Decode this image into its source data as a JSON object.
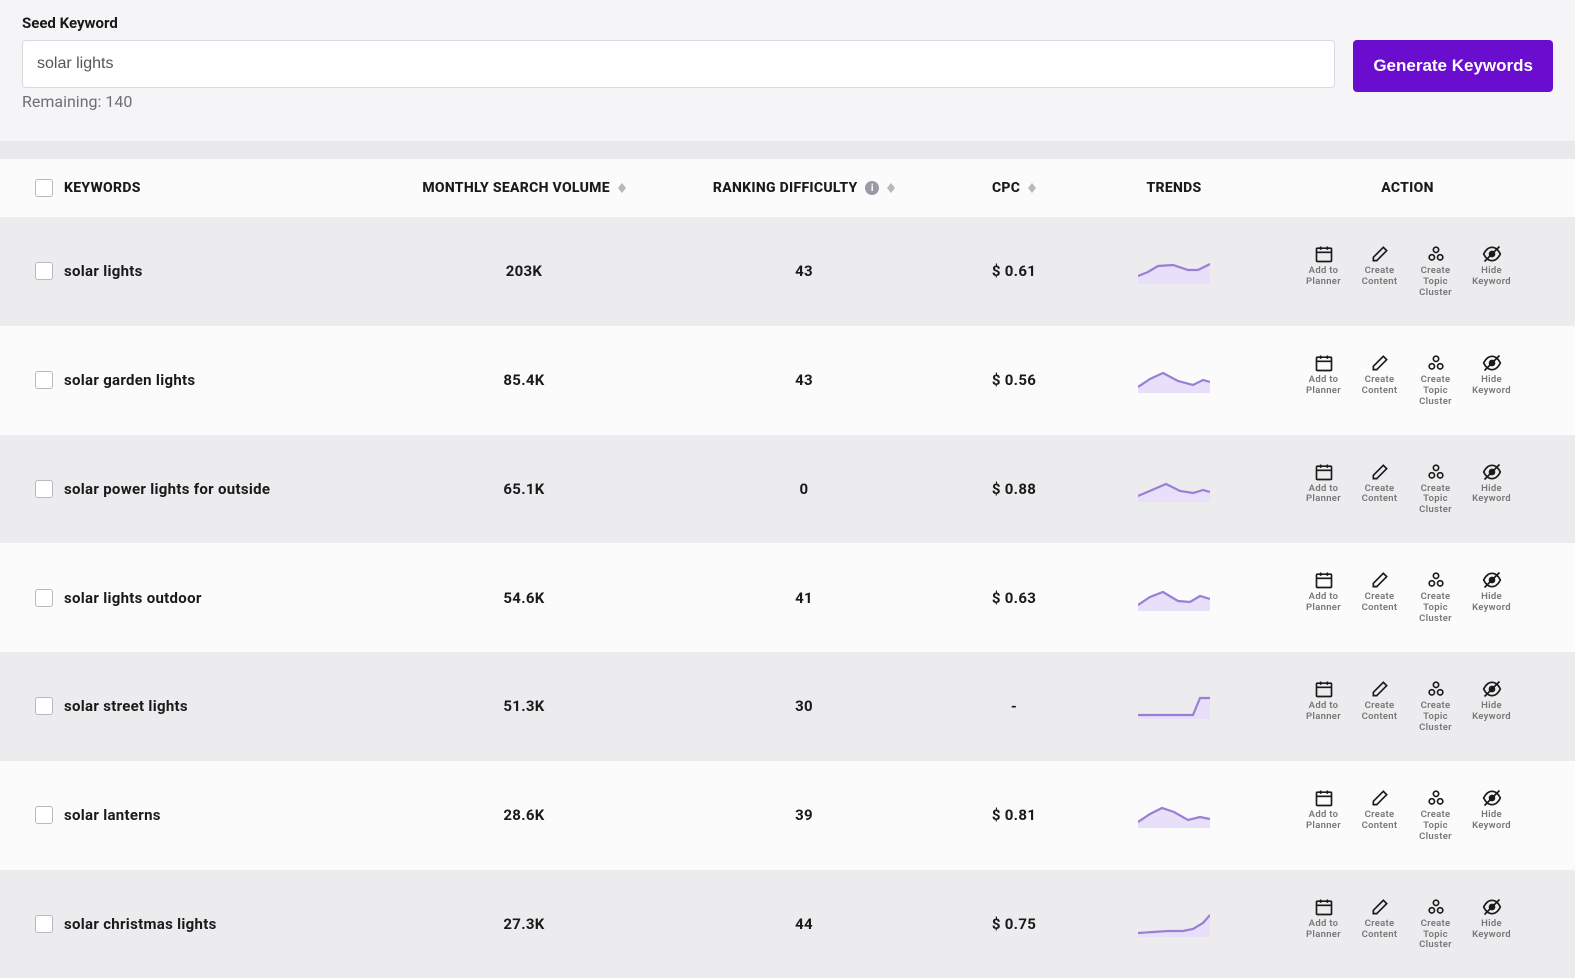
{
  "seed": {
    "label": "Seed Keyword",
    "value": "solar lights",
    "remaining": "Remaining: 140",
    "button": "Generate Keywords"
  },
  "headers": {
    "keywords": "KEYWORDS",
    "volume": "MONTHLY SEARCH VOLUME",
    "difficulty": "RANKING DIFFICULTY",
    "cpc": "CPC",
    "trends": "TRENDS",
    "action": "ACTION"
  },
  "actions": {
    "planner": "Add to Planner",
    "content": "Create Content",
    "cluster": "Create Topic Cluster",
    "hide": "Hide Keyword"
  },
  "rows": [
    {
      "keyword": "solar lights",
      "volume": "203K",
      "difficulty": "43",
      "cpc": "$ 0.61",
      "trend": "0,18 10,14 20,8 35,7 50,12 60,12 72,6"
    },
    {
      "keyword": "solar garden lights",
      "volume": "85.4K",
      "difficulty": "43",
      "cpc": "$ 0.56",
      "trend": "0,20 12,12 25,6 40,14 55,18 65,13 72,15"
    },
    {
      "keyword": "solar power lights for outside",
      "volume": "65.1K",
      "difficulty": "0",
      "cpc": "$ 0.88",
      "trend": "0,20 14,14 28,8 42,15 55,17 65,14 72,16"
    },
    {
      "keyword": "solar lights outdoor",
      "volume": "54.6K",
      "difficulty": "41",
      "cpc": "$ 0.63",
      "trend": "0,20 12,12 25,7 40,16 52,17 62,11 72,14"
    },
    {
      "keyword": "solar street lights",
      "volume": "51.3K",
      "difficulty": "30",
      "cpc": "-",
      "trend": "0,22 15,22 30,22 45,22 55,22 62,5 72,5"
    },
    {
      "keyword": "solar lanterns",
      "volume": "28.6K",
      "difficulty": "39",
      "cpc": "$ 0.81",
      "trend": "0,20 12,12 24,6 36,10 50,18 62,15 72,17"
    },
    {
      "keyword": "solar christmas lights",
      "volume": "27.3K",
      "difficulty": "44",
      "cpc": "$ 0.75",
      "trend": "0,22 15,21 30,20 45,20 55,18 65,12 72,4"
    }
  ]
}
